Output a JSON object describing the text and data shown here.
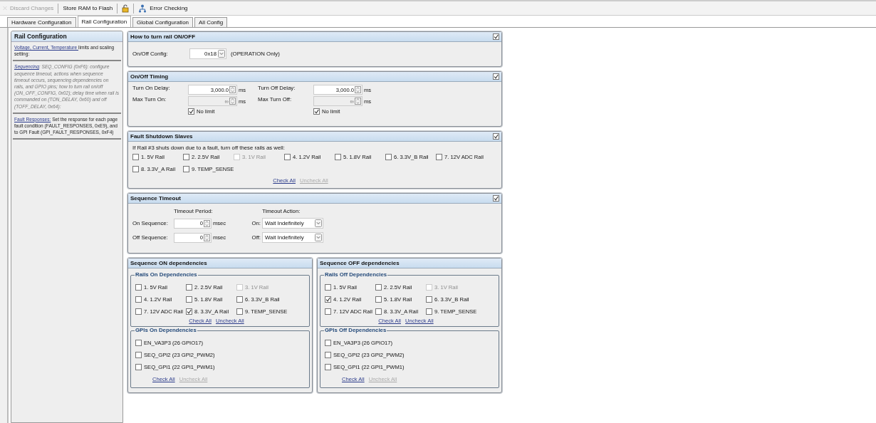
{
  "toolbar": [
    {
      "kind": "close",
      "label": "Discard Changes",
      "disabled": true
    },
    {
      "kind": "text",
      "label": "Store RAM to Flash",
      "disabled": false
    },
    {
      "kind": "lock",
      "disabled": false
    },
    {
      "kind": "tree",
      "label": "Error Checking",
      "disabled": false
    }
  ],
  "tabs": [
    {
      "label": "Hardware Configuration",
      "selected": false
    },
    {
      "label": "Rail Configuration",
      "selected": true
    },
    {
      "label": "Global Configuration",
      "selected": false
    },
    {
      "label": "All Config",
      "selected": false
    }
  ],
  "sidebar": {
    "title": "Rail Configuration",
    "sections": [
      {
        "link": "Voltage, Current, Temperature ",
        "text": "limits and scaling setting:",
        "italic": false
      },
      {
        "link": "Sequencing",
        "text": ": SEQ_CONFIG (0xF6): configure sequence timeout, actions when sequence timeout occurs, sequencing dependencies on rails, and GPIO pins; how to turn rail on/off (ON_OFF_CONFIG, 0x02); delay time when rail is commanded on (TON_DELAY, 0x60) and off (TOFF_DELAY, 0x64):",
        "italic": true
      },
      {
        "link": "Fault Responses:",
        "text": " Set the response for each page fault condition (FAULT_RESPONSES, 0xE9), and to GPI Fault (GPI_FAULT_RESPONSES, 0xF4)",
        "italic": false
      }
    ]
  },
  "on_off": {
    "title": "How to turn rail ON/OFF",
    "checked": true,
    "label": "On/Off Config:",
    "value": "0x18",
    "note": "(OPERATION Only)"
  },
  "timing": {
    "title": "On/Off Timing",
    "checked": true,
    "fields": [
      {
        "label": "Turn On Delay:",
        "value": "3,000.0",
        "unit": "ms",
        "disabled": false
      },
      {
        "label": "Turn Off Delay:",
        "value": "3,000.0",
        "unit": "ms",
        "disabled": false
      },
      {
        "label": "Max Turn On:",
        "value": "∞",
        "unit": "ms",
        "disabled": true,
        "no_limit": {
          "label": "No limit",
          "checked": true
        }
      },
      {
        "label": "Max Turn Off:",
        "value": "∞",
        "unit": "ms",
        "disabled": true,
        "no_limit": {
          "label": "No limit",
          "checked": true
        }
      }
    ]
  },
  "fault": {
    "title": "Fault Shutdown Slaves",
    "checked": true,
    "prompt": "If Rail #3 shuts down due to a fault, turn off these rails as well:",
    "rails": [
      {
        "label": "1. 5V Rail",
        "checked": false,
        "disabled": false
      },
      {
        "label": "2. 2.5V Rail",
        "checked": false,
        "disabled": false
      },
      {
        "label": "3. 1V Rail",
        "checked": false,
        "disabled": true
      },
      {
        "label": "4. 1.2V Rail",
        "checked": false,
        "disabled": false
      },
      {
        "label": "5. 1.8V Rail",
        "checked": false,
        "disabled": false
      },
      {
        "label": "6. 3.3V_B Rail",
        "checked": false,
        "disabled": false
      },
      {
        "label": "7. 12V ADC Rail",
        "checked": false,
        "disabled": false
      },
      {
        "label": "8. 3.3V_A Rail",
        "checked": false,
        "disabled": false
      },
      {
        "label": "9. TEMP_SENSE",
        "checked": false,
        "disabled": false
      }
    ],
    "links": [
      {
        "label": "Check All",
        "disabled": false
      },
      {
        "label": "Uncheck All",
        "disabled": true
      }
    ]
  },
  "timeout": {
    "title": "Sequence Timeout",
    "checked": true,
    "period_header": "Timeout Period:",
    "action_header": "Timeout Action:",
    "rows": [
      {
        "label": "On Sequence:",
        "value": "0",
        "unit": "msec",
        "action_label": "On:",
        "action": "Wait Indefinitely"
      },
      {
        "label": "Off Sequence:",
        "value": "0",
        "unit": "msec",
        "action_label": "Off:",
        "action": "Wait Indefinitely"
      }
    ]
  },
  "dependencies": [
    {
      "title": "Sequence ON dependencies",
      "groups": [
        {
          "kind": "rails",
          "title": "Rails On Dependencies",
          "items": [
            {
              "label": "1. 5V Rail",
              "checked": false,
              "disabled": false
            },
            {
              "label": "2. 2.5V Rail",
              "checked": false,
              "disabled": false
            },
            {
              "label": "3. 1V Rail",
              "checked": false,
              "disabled": true
            },
            {
              "label": "4. 1.2V Rail",
              "checked": false,
              "disabled": false
            },
            {
              "label": "5. 1.8V Rail",
              "checked": false,
              "disabled": false
            },
            {
              "label": "6. 3.3V_B Rail",
              "checked": false,
              "disabled": false
            },
            {
              "label": "7. 12V ADC Rail",
              "checked": false,
              "disabled": false
            },
            {
              "label": "8. 3.3V_A Rail",
              "checked": true,
              "disabled": false
            },
            {
              "label": "9. TEMP_SENSE",
              "checked": false,
              "disabled": false
            }
          ],
          "links": [
            {
              "label": "Check All",
              "disabled": false
            },
            {
              "label": "Uncheck All",
              "disabled": false
            }
          ]
        },
        {
          "kind": "gpis",
          "title": "GPIs On Dependencies",
          "items": [
            {
              "label": "EN_VA3P3 (26 GPIO17)",
              "checked": false,
              "disabled": false
            },
            {
              "label": "SEQ_GPI2 (23 GPI2_PWM2)",
              "checked": false,
              "disabled": false
            },
            {
              "label": "SEQ_GPI1 (22 GPI1_PWM1)",
              "checked": false,
              "disabled": false
            }
          ],
          "links": [
            {
              "label": "Check All",
              "disabled": false
            },
            {
              "label": "Uncheck All",
              "disabled": true
            }
          ]
        }
      ]
    },
    {
      "title": "Sequence OFF dependencies",
      "groups": [
        {
          "kind": "rails",
          "title": "Rails Off Dependencies",
          "items": [
            {
              "label": "1. 5V Rail",
              "checked": false,
              "disabled": false
            },
            {
              "label": "2. 2.5V Rail",
              "checked": false,
              "disabled": false
            },
            {
              "label": "3. 1V Rail",
              "checked": false,
              "disabled": true
            },
            {
              "label": "4. 1.2V Rail",
              "checked": true,
              "disabled": false
            },
            {
              "label": "5. 1.8V Rail",
              "checked": false,
              "disabled": false
            },
            {
              "label": "6. 3.3V_B Rail",
              "checked": false,
              "disabled": false
            },
            {
              "label": "7. 12V ADC Rail",
              "checked": false,
              "disabled": false
            },
            {
              "label": "8. 3.3V_A Rail",
              "checked": false,
              "disabled": false
            },
            {
              "label": "9. TEMP_SENSE",
              "checked": false,
              "disabled": false
            }
          ],
          "links": [
            {
              "label": "Check All",
              "disabled": false
            },
            {
              "label": "Uncheck All",
              "disabled": false
            }
          ]
        },
        {
          "kind": "gpis",
          "title": "GPIs Off Dependencies",
          "items": [
            {
              "label": "EN_VA3P3 (26 GPIO17)",
              "checked": false,
              "disabled": false
            },
            {
              "label": "SEQ_GPI2 (23 GPI2_PWM2)",
              "checked": false,
              "disabled": false
            },
            {
              "label": "SEQ_GPI1 (22 GPI1_PWM1)",
              "checked": false,
              "disabled": false
            }
          ],
          "links": [
            {
              "label": "Check All",
              "disabled": false
            },
            {
              "label": "Uncheck All",
              "disabled": true
            }
          ]
        }
      ]
    }
  ]
}
